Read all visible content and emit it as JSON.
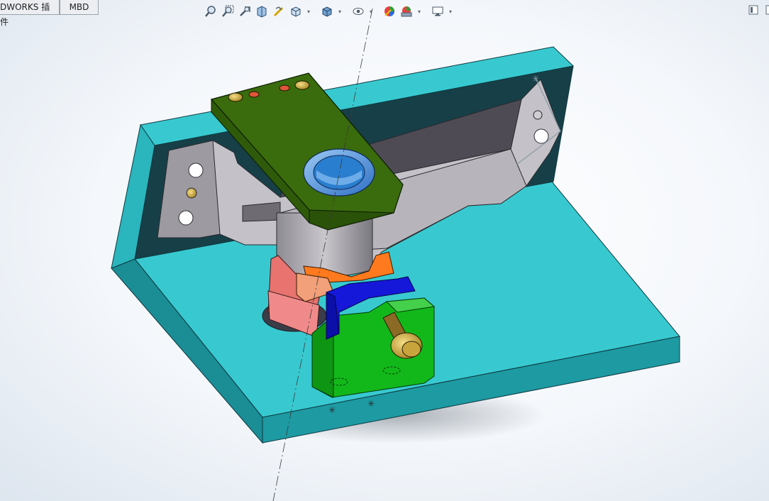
{
  "tabs": [
    {
      "label": "DWORKS 插件"
    },
    {
      "label": "MBD"
    }
  ],
  "toolbar": {
    "items": [
      {
        "icon": "zoom-to-fit-icon"
      },
      {
        "icon": "zoom-to-area-icon"
      },
      {
        "icon": "previous-view-icon"
      },
      {
        "icon": "section-view-icon"
      },
      {
        "icon": "dynamic-annotation-icon"
      },
      {
        "icon": "view-orientation-icon"
      },
      {
        "icon": "display-style-icon"
      },
      {
        "icon": "hide-show-items-icon"
      },
      {
        "icon": "edit-appearance-icon"
      },
      {
        "icon": "apply-scene-icon"
      },
      {
        "icon": "view-settings-icon"
      }
    ]
  },
  "colors": {
    "base_top": "#38c9d0",
    "base_side": "#1d9aa2",
    "base_dark": "#173f48",
    "clamp_arm": "#3a6b0d",
    "bushing": "#4f8fe0",
    "fixture_green": "#12b81a",
    "fixture_blue": "#1518d8",
    "part_gray": "#b8b6bc",
    "orange": "#ff7a1e",
    "pink": "#f08a8a"
  }
}
